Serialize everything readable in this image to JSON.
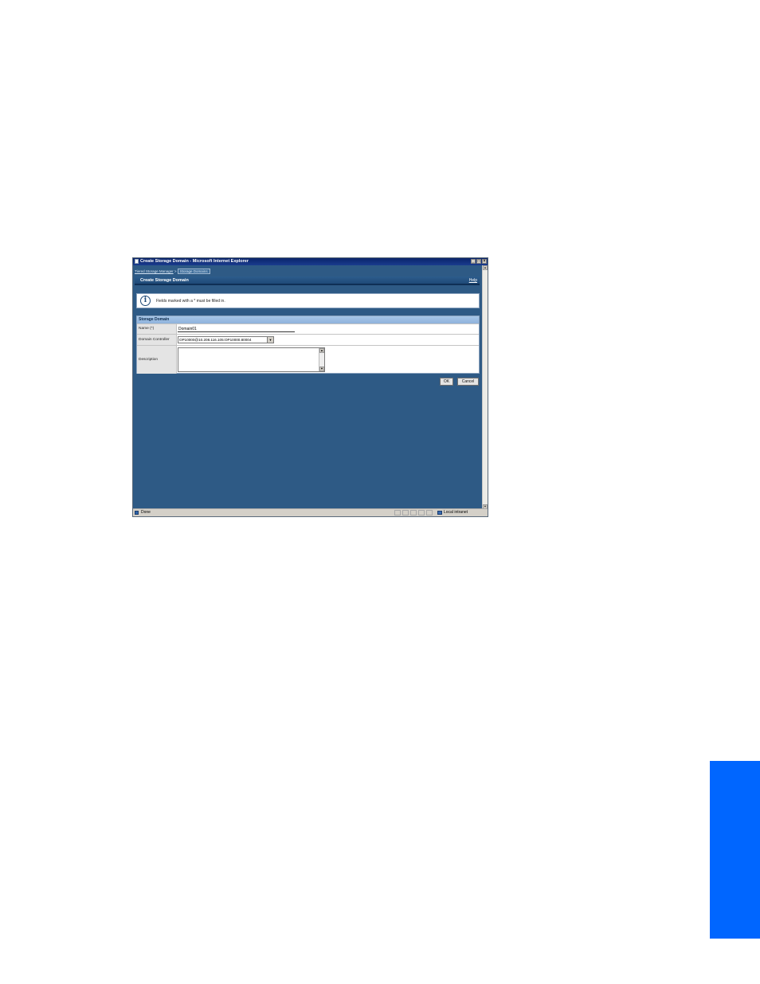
{
  "window": {
    "title": "Create Storage Domain - Microsoft Internet Explorer",
    "minimize_glyph": "_",
    "maximize_glyph": "□",
    "close_glyph": "×"
  },
  "breadcrumb": {
    "parent": "Tiered Storage Manager",
    "separator": ">",
    "current": "Storage Domains"
  },
  "header": {
    "title": "Create Storage Domain",
    "help": "Help"
  },
  "info": {
    "icon": "info-icon",
    "glyph": "i",
    "text": "Fields marked with a * must be filled in."
  },
  "panel": {
    "title": "Storage Domain",
    "name_label": "Name (*)",
    "name_value": "Domain01",
    "controller_label": "Domain Controller",
    "controller_value": "OP10000@10.208.116.105:OP10000.80004",
    "description_label": "Description",
    "description_value": ""
  },
  "buttons": {
    "ok": "OK",
    "cancel": "Cancel"
  },
  "status": {
    "text": "Done",
    "zone": "Local intranet"
  },
  "colors": {
    "page_bg": "#2e5a85",
    "accent_tab": "#0066ff",
    "panel_header": "#8fb3dc"
  }
}
